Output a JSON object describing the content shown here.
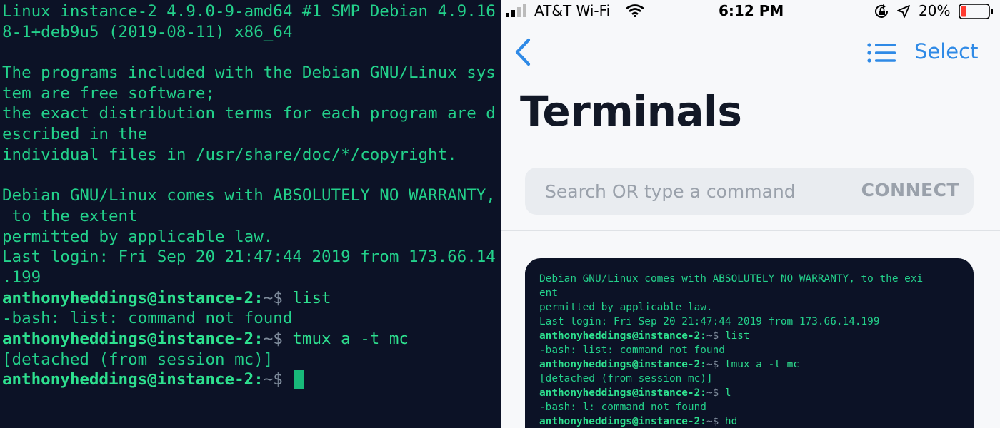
{
  "left_terminal": {
    "lines": [
      {
        "kind": "out",
        "text": "Linux instance-2 4.9.0-9-amd64 #1 SMP Debian 4.9.16"
      },
      {
        "kind": "out",
        "text": "8-1+deb9u5 (2019-08-11) x86_64"
      },
      {
        "kind": "out",
        "text": ""
      },
      {
        "kind": "out",
        "text": "The programs included with the Debian GNU/Linux sys"
      },
      {
        "kind": "out",
        "text": "tem are free software;"
      },
      {
        "kind": "out",
        "text": "the exact distribution terms for each program are d"
      },
      {
        "kind": "out",
        "text": "escribed in the"
      },
      {
        "kind": "out",
        "text": "individual files in /usr/share/doc/*/copyright."
      },
      {
        "kind": "out",
        "text": ""
      },
      {
        "kind": "out",
        "text": "Debian GNU/Linux comes with ABSOLUTELY NO WARRANTY,"
      },
      {
        "kind": "out",
        "text": " to the extent"
      },
      {
        "kind": "out",
        "text": "permitted by applicable law."
      },
      {
        "kind": "out",
        "text": "Last login: Fri Sep 20 21:47:44 2019 from 173.66.14"
      },
      {
        "kind": "out",
        "text": ".199"
      },
      {
        "kind": "prompt",
        "user": "anthonyheddings@instance-2:",
        "path": "~$",
        "cmd": " list"
      },
      {
        "kind": "out",
        "text": "-bash: list: command not found"
      },
      {
        "kind": "prompt",
        "user": "anthonyheddings@instance-2:",
        "path": "~$",
        "cmd": " tmux a -t mc"
      },
      {
        "kind": "out",
        "text": "[detached (from session mc)]"
      },
      {
        "kind": "prompt",
        "user": "anthonyheddings@instance-2:",
        "path": "~$",
        "cmd": " ",
        "cursor": true
      }
    ]
  },
  "status_bar": {
    "carrier": "AT&T Wi-Fi",
    "time": "6:12 PM",
    "battery_percent": "20%",
    "icons": [
      "signal-bars-icon",
      "wifi-icon",
      "rotation-lock-icon",
      "location-arrow-icon",
      "battery-low-icon"
    ],
    "battery_level": 0.2,
    "battery_color": "#ff3b30"
  },
  "nav": {
    "back_icon": "chevron-left-icon",
    "list_icon": "list-icon",
    "select_label": "Select",
    "accent_color": "#2f8ae6"
  },
  "page": {
    "title": "Terminals"
  },
  "search": {
    "placeholder": "Search OR type a command",
    "value": "",
    "connect_label": "CONNECT"
  },
  "terminal_card": {
    "lines": [
      {
        "kind": "out",
        "text": "Debian GNU/Linux comes with ABSOLUTELY NO WARRANTY, to the exi"
      },
      {
        "kind": "out",
        "text": "ent"
      },
      {
        "kind": "out",
        "text": "permitted by applicable law."
      },
      {
        "kind": "out",
        "text": "Last login: Fri Sep 20 21:47:44 2019 from 173.66.14.199"
      },
      {
        "kind": "prompt",
        "user": "anthonyheddings@instance-2:",
        "path": "~$",
        "cmd": " list"
      },
      {
        "kind": "out",
        "text": "-bash: list: command not found"
      },
      {
        "kind": "prompt",
        "user": "anthonyheddings@instance-2:",
        "path": "~$",
        "cmd": " tmux a -t mc"
      },
      {
        "kind": "out",
        "text": "[detached (from session mc)]"
      },
      {
        "kind": "prompt",
        "user": "anthonyheddings@instance-2:",
        "path": "~$",
        "cmd": " l"
      },
      {
        "kind": "out",
        "text": "-bash: l: command not found"
      },
      {
        "kind": "prompt",
        "user": "anthonyheddings@instance-2:",
        "path": "~$",
        "cmd": " hd"
      }
    ]
  },
  "colors": {
    "terminal_bg": "#0c1226",
    "terminal_text": "#23d18b",
    "prompt_path": "#7f8c9c",
    "title_text": "#121826",
    "muted_text": "#9aa1ab"
  }
}
